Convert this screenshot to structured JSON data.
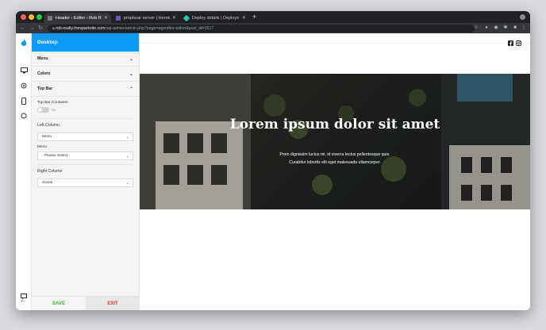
{
  "browser": {
    "tabs": [
      {
        "label": "Header ‹ Editor ‹ Rob Realty",
        "active": true
      },
      {
        "label": "propbear-server | Heroku",
        "active": false
      },
      {
        "label": "Deploy details | Deploys",
        "active": false
      }
    ],
    "url_host": "rob-realty.thesparksite.com",
    "url_path": "/wp-admin/admin.php?page=agentfire-editor&post_id=1617"
  },
  "editor": {
    "title": "Desktop",
    "sections": {
      "menu": "Menu",
      "colors": "Colors",
      "top_bar": "Top Bar"
    },
    "top_bar": {
      "container_label": "Top Bar Container",
      "container_state": "No",
      "left_column_label": "Left Column",
      "left_select_value": "Menu",
      "menu_label": "Menu",
      "menu_select_value": "- Please Select -",
      "right_column_label": "Right Column",
      "right_select_value": "Social"
    },
    "save_label": "SAVE",
    "exit_label": "EXIT"
  },
  "preview": {
    "hero_title": "Lorem ipsum dolor sit amet",
    "hero_subtitle_line1": "Proin dignissim luctus mi, id viverra lectus pellentesque quis.",
    "hero_subtitle_line2": "Curabitur lobortis elit eget malesuada ullamcorper."
  },
  "colors": {
    "accent": "#0d9af9",
    "save": "#3dae2b",
    "exit": "#e2312c"
  }
}
